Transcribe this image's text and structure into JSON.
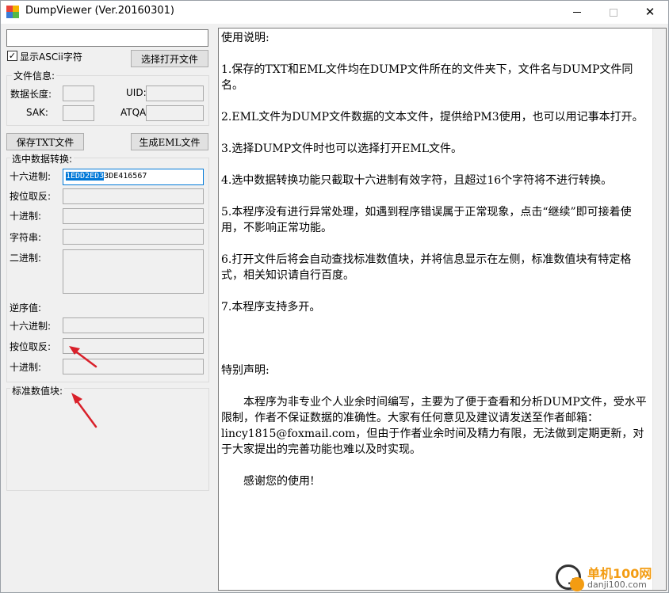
{
  "window": {
    "title": "DumpViewer (Ver.20160301)"
  },
  "left": {
    "path_value": "",
    "show_ascii_label": "显示ASCii字符",
    "show_ascii_checked": true,
    "open_file_button": "选择打开文件",
    "file_info": {
      "caption": "文件信息:",
      "data_length_label": "数据长度:",
      "uid_label": "UID:",
      "sak_label": "SAK:",
      "atqa_label": "ATQA:"
    },
    "save_txt_button": "保存TXT文件",
    "gen_eml_button": "生成EML文件",
    "convert": {
      "caption": "选中数据转换:",
      "hex_label": "十六进制:",
      "hex_value_selected": "1EDD2ED3",
      "hex_value_rest": "3DE416567",
      "bitinv_label": "按位取反:",
      "dec_label": "十进制:",
      "str_label": "字符串:",
      "bin_label": "二进制:",
      "reverse_caption": "逆序值:",
      "rev_hex_label": "十六进制:",
      "rev_bitinv_label": "按位取反:",
      "rev_dec_label": "十进制:"
    },
    "std_block_caption": "标准数值块:"
  },
  "doc": {
    "heading": "使用说明:",
    "items": [
      "1.保存的TXT和EML文件均在DUMP文件所在的文件夹下，文件名与DUMP文件同名。",
      "2.EML文件为DUMP文件数据的文本文件，提供给PM3使用，也可以用记事本打开。",
      "3.选择DUMP文件时也可以选择打开EML文件。",
      "4.选中数据转换功能只截取十六进制有效字符，且超过16个字符将不进行转换。",
      "5.本程序没有进行异常处理，如遇到程序错误属于正常现象，点击“继续”即可接着使用，不影响正常功能。",
      "6.打开文件后将会自动查找标准数值块，并将信息显示在左侧，标准数值块有特定格式，相关知识请自行百度。",
      "7.本程序支持多开。"
    ],
    "special_heading": "特别声明:",
    "special_body": "本程序为非专业个人业余时间编写，主要为了便于查看和分析DUMP文件，受水平限制，作者不保证数据的准确性。大家有任何意见及建议请发送至作者邮箱：lincy1815@foxmail.com，但由于作者业余时间及精力有限，无法做到定期更新，对于大家提出的完善功能也难以及时实现。",
    "thanks": "感谢您的使用!"
  },
  "watermark": {
    "text_main": "单机100网",
    "text_sub": "danji100.com"
  },
  "colors": {
    "selection": "#0078d7",
    "arrow": "#d9202a",
    "watermark": "#f39c12"
  }
}
